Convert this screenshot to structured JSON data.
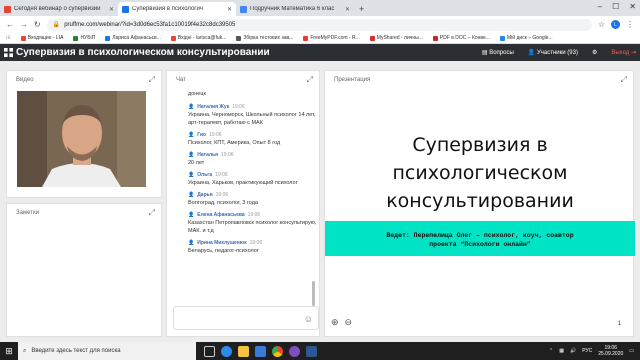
{
  "browser": {
    "tabs": [
      {
        "label": "Сегодня вебинар о супервизии",
        "color": "#ea4335",
        "active": false
      },
      {
        "label": "Супервизия в психологич",
        "color": "#1a73e8",
        "active": true
      },
      {
        "label": "Подручник Математика 6 клас",
        "color": "#4285f4",
        "active": false
      }
    ],
    "url": "pruffme.com/webinar/?id=3d0d6ec53fa1c10019f4e32c8dc39505",
    "avatar_letter": "L",
    "bookmarks": [
      {
        "label": "Входящие - LIA",
        "color": "#ea4335"
      },
      {
        "label": "НУБіП",
        "color": "#2e7d32"
      },
      {
        "label": "Лариса Афанасьєв...",
        "color": "#1a73e8"
      },
      {
        "label": "Вхідні - larisca@fuk...",
        "color": "#ea4335"
      },
      {
        "label": "Збірка тестових зав...",
        "color": "#555555"
      },
      {
        "label": "FreeMyPDF.com - R...",
        "color": "#e53935"
      },
      {
        "label": "MyShared - личны...",
        "color": "#d32f2f"
      },
      {
        "label": "PDF в DOC – Конве...",
        "color": "#c62828"
      },
      {
        "label": "Мій диск – Google...",
        "color": "#1e88e5"
      }
    ]
  },
  "app": {
    "title": "Супервизия в психологическом консультировании",
    "questions_label": "Вопросы",
    "participants_label": "Участники (93)",
    "exit_label": "Выход"
  },
  "video_panel": {
    "label": "Видео"
  },
  "notes_panel": {
    "label": "Заметки"
  },
  "chat": {
    "label": "Чат",
    "first_line": "донецк",
    "messages": [
      {
        "name": "Наталия Жук",
        "time": "19:06",
        "text": "Украина, Черноморск, Школьный психолог 14 лет, арт-терапевт, работаю с МАК"
      },
      {
        "name": "Гио",
        "time": "19:06",
        "text": "Психолог, КПТ, Америка, Опыт 8 год"
      },
      {
        "name": "Наталья",
        "time": "19:06",
        "text": "20 лет"
      },
      {
        "name": "Ольга",
        "time": "19:06",
        "text": "Украина, Харьков, практикующий психолог"
      },
      {
        "name": "Дарья",
        "time": "19:06",
        "text": "Волгоград, психолог, 3 года"
      },
      {
        "name": "Елена Афанасьева",
        "time": "19:06",
        "text": "Казахстан Петропавловск психолог консультирую, МАК. и т.д"
      },
      {
        "name": "Ирина Миклушенюк",
        "time": "19:06",
        "text": "Беларусь, педагог-психолог"
      }
    ]
  },
  "presentation": {
    "label": "Презентация",
    "slide_title_line1": "Супервизия в психологическом",
    "slide_title_line2": "консультировании",
    "banner_line1": "Ведет: Перепелица Олег – психолог, коуч, соавтор",
    "banner_line2": "проекта “Психологи онлайн”",
    "page": "1"
  },
  "taskbar": {
    "search_placeholder": "Введите здесь текст для поиска",
    "lang": "РУС",
    "time": "19:06",
    "date": "25.09.2020"
  }
}
